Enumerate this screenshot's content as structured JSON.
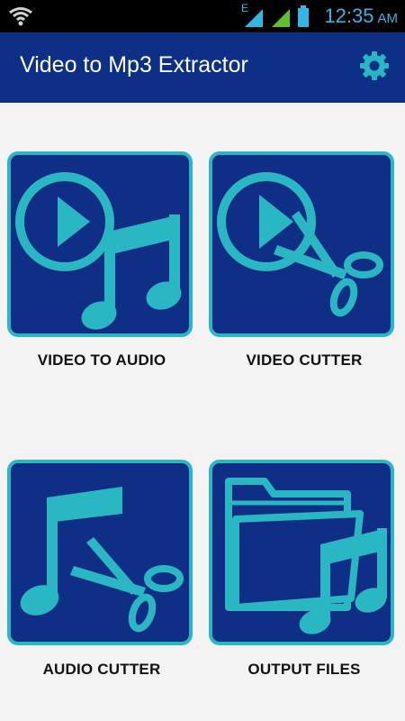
{
  "statusbar": {
    "time": "12:35",
    "ampm": "AM",
    "network_label": "E"
  },
  "appbar": {
    "title": "Video to Mp3 Extractor"
  },
  "tiles": [
    {
      "label": "VIDEO TO AUDIO"
    },
    {
      "label": "VIDEO CUTTER"
    },
    {
      "label": "AUDIO CUTTER"
    },
    {
      "label": "OUTPUT FILES"
    }
  ],
  "colors": {
    "primary": "#0d2f85",
    "accent": "#2ab7c4",
    "statusbar": "#000000"
  },
  "icons": [
    "wifi-icon",
    "signal-icon",
    "battery-icon",
    "gear-icon",
    "play-icon",
    "music-note-icon",
    "scissors-icon",
    "folder-icon"
  ]
}
